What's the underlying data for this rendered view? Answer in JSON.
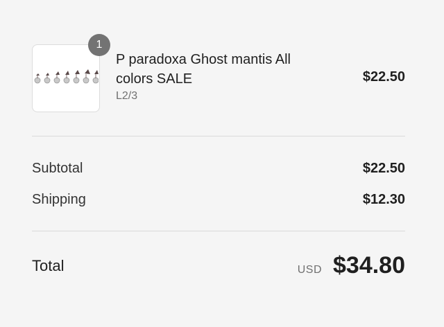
{
  "line_item": {
    "quantity": "1",
    "title": "P paradoxa Ghost mantis All colors SALE",
    "variant": "L2/3",
    "price": "$22.50",
    "thumbnail_icon": "mantis-product-photo"
  },
  "summary": {
    "subtotal_label": "Subtotal",
    "subtotal_value": "$22.50",
    "shipping_label": "Shipping",
    "shipping_value": "$12.30"
  },
  "total": {
    "label": "Total",
    "currency": "USD",
    "value": "$34.80"
  },
  "colors": {
    "background": "#f5f5f5",
    "badge": "#737373",
    "text": "#1f1f1f",
    "muted": "#707070",
    "divider": "#d9d9d9"
  }
}
